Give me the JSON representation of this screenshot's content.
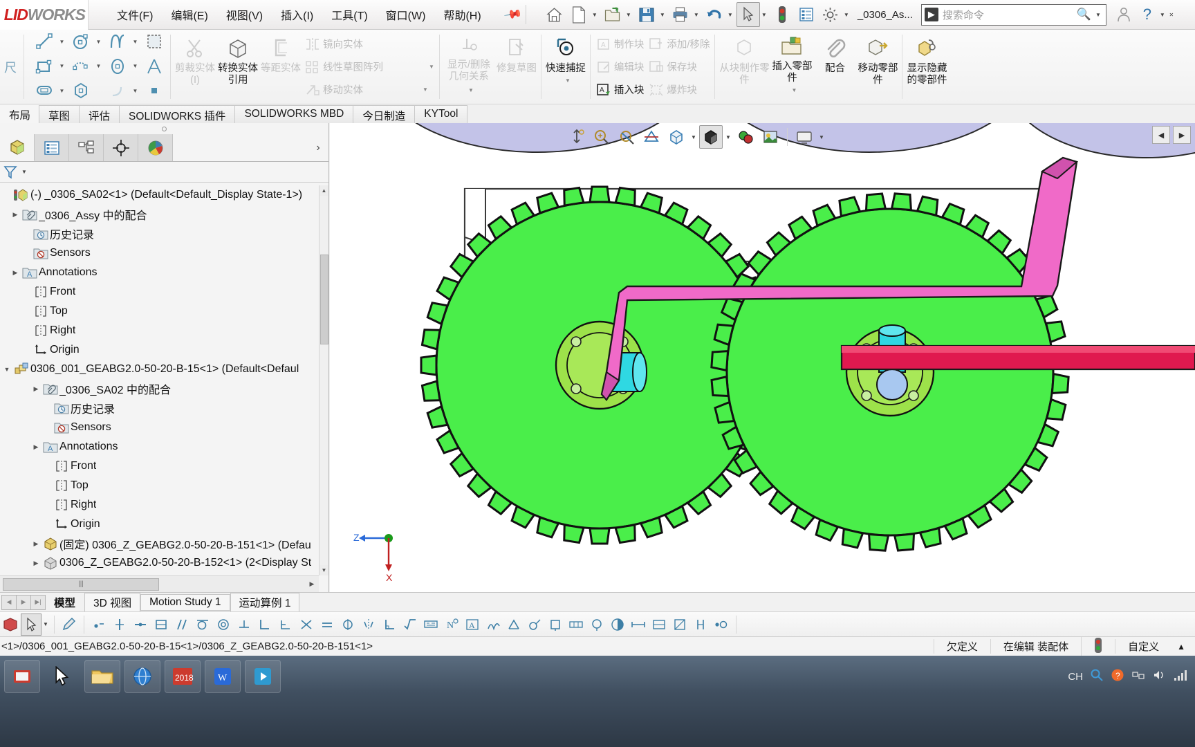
{
  "app": {
    "logo_part1": "LID",
    "logo_part2": "WORKS",
    "document_name": "_0306_As...",
    "search_placeholder": "搜索命令",
    "search_icon": "search-icon"
  },
  "menubar": {
    "items": [
      {
        "label": "文件(F)",
        "name": "menu-file"
      },
      {
        "label": "编辑(E)",
        "name": "menu-edit"
      },
      {
        "label": "视图(V)",
        "name": "menu-view"
      },
      {
        "label": "插入(I)",
        "name": "menu-insert"
      },
      {
        "label": "工具(T)",
        "name": "menu-tools"
      },
      {
        "label": "窗口(W)",
        "name": "menu-window"
      },
      {
        "label": "帮助(H)",
        "name": "menu-help"
      }
    ],
    "pin": "pin-icon"
  },
  "quick_access": [
    {
      "name": "home-icon",
      "caret": false
    },
    {
      "name": "new-document-icon",
      "caret": true
    },
    {
      "name": "open-folder-icon",
      "caret": true
    },
    {
      "name": "save-icon",
      "caret": true
    },
    {
      "name": "print-icon",
      "caret": true
    },
    {
      "name": "undo-icon",
      "caret": true
    },
    {
      "name": "select-cursor-icon",
      "caret": true
    },
    {
      "name": "rebuild-icon",
      "caret": false
    },
    {
      "name": "options-list-icon",
      "caret": false
    },
    {
      "name": "settings-gear-icon",
      "caret": true
    }
  ],
  "ribbon": {
    "sketch_entities": [
      {
        "name": "line-icon",
        "caret": true
      },
      {
        "name": "circle-icon",
        "caret": true
      },
      {
        "name": "spline-icon",
        "caret": true
      },
      {
        "name": "sketch-fillet-icon",
        "caret": false
      },
      {
        "name": "rectangle-icon",
        "caret": true
      },
      {
        "name": "slot-icon",
        "caret": true
      },
      {
        "name": "ellipse-icon",
        "caret": true
      },
      {
        "name": "text-icon",
        "caret": false
      },
      {
        "name": "straight-slot-icon",
        "caret": true
      },
      {
        "name": "polygon-icon",
        "caret": false
      },
      {
        "name": "arc-icon",
        "caret": true
      },
      {
        "name": "point-icon",
        "caret": false
      }
    ],
    "big_buttons": [
      {
        "label": "剪裁实体(I)",
        "name": "trim-entities-button",
        "dim": true,
        "icon": "trim-icon"
      },
      {
        "label": "转换实体引用",
        "name": "convert-entities-button",
        "dim": false,
        "icon": "convert-entities-icon"
      },
      {
        "label": "等距实体",
        "name": "offset-entities-button",
        "dim": true,
        "icon": "offset-entities-icon"
      }
    ],
    "mid_small": [
      {
        "label": "镜向实体",
        "name": "mirror-entities-button",
        "icon": "mirror-icon",
        "caret": false
      },
      {
        "label": "线性草图阵列",
        "name": "linear-pattern-button",
        "icon": "linear-pattern-icon",
        "caret": true
      },
      {
        "label": "移动实体",
        "name": "move-entities-button",
        "icon": "move-entities-icon",
        "caret": true
      }
    ],
    "relations": [
      {
        "label": "显示/删除几何关系",
        "name": "display-delete-relations-button",
        "dim": true,
        "icon": "relations-icon",
        "caret": true
      },
      {
        "label": "修复草图",
        "name": "repair-sketch-button",
        "dim": true,
        "icon": "repair-sketch-icon",
        "caret": false
      },
      {
        "label": "快速捕捉",
        "name": "quick-snaps-button",
        "dim": false,
        "icon": "quick-snap-icon",
        "caret": true
      }
    ],
    "blocks": [
      {
        "label": "制作块",
        "name": "make-block-button",
        "icon": "make-block-icon",
        "dim": true
      },
      {
        "label": "编辑块",
        "name": "edit-block-button",
        "icon": "edit-block-icon",
        "dim": true
      },
      {
        "label": "插入块",
        "name": "insert-block-button",
        "icon": "insert-block-icon",
        "dim": false
      },
      {
        "label": "添加/移除",
        "name": "add-remove-button",
        "icon": "add-remove-icon",
        "dim": true
      },
      {
        "label": "保存块",
        "name": "save-block-button",
        "icon": "save-block-icon",
        "dim": true
      },
      {
        "label": "爆炸块",
        "name": "explode-block-button",
        "icon": "explode-block-icon",
        "dim": true
      }
    ],
    "assembly": [
      {
        "label": "从块制作零件",
        "name": "make-part-from-block-button",
        "dim": true,
        "icon": "make-part-icon",
        "caret": false
      },
      {
        "label": "插入零部件",
        "name": "insert-components-button",
        "dim": false,
        "icon": "insert-component-icon",
        "caret": true
      },
      {
        "label": "配合",
        "name": "mate-button",
        "dim": false,
        "icon": "mate-paperclip-icon",
        "caret": false
      },
      {
        "label": "移动零部件",
        "name": "move-component-button",
        "dim": false,
        "icon": "move-component-icon",
        "caret": false
      },
      {
        "label": "显示隐藏的零部件",
        "name": "show-hidden-components-button",
        "dim": false,
        "icon": "show-hidden-icon",
        "caret": false
      }
    ]
  },
  "command_tabs": [
    {
      "label": "布局",
      "name": "tab-layout",
      "selected": true
    },
    {
      "label": "草图",
      "name": "tab-sketch",
      "selected": false
    },
    {
      "label": "评估",
      "name": "tab-evaluate",
      "selected": false
    },
    {
      "label": "SOLIDWORKS 插件",
      "name": "tab-solidworks-addins",
      "selected": false
    },
    {
      "label": "SOLIDWORKS MBD",
      "name": "tab-solidworks-mbd",
      "selected": false
    },
    {
      "label": "今日制造",
      "name": "tab-manufacturing-today",
      "selected": false
    },
    {
      "label": "KYTool",
      "name": "tab-kytool",
      "selected": false
    }
  ],
  "left_panel": {
    "tabs": [
      {
        "name": "feature-manager-tab",
        "icon": "feature-tree-icon",
        "selected": true
      },
      {
        "name": "property-manager-tab",
        "icon": "property-list-icon",
        "selected": false
      },
      {
        "name": "configuration-manager-tab",
        "icon": "configuration-icon",
        "selected": false
      },
      {
        "name": "dimxpert-manager-tab",
        "icon": "dimxpert-icon",
        "selected": false
      },
      {
        "name": "display-manager-tab",
        "icon": "appearance-sphere-icon",
        "selected": false
      }
    ],
    "filter_icon": "filter-icon",
    "tree": [
      {
        "label": "(-) _0306_SA02<1>  (Default<Default_Display State-1>)",
        "indent": 0,
        "expander": "",
        "icon": "assembly-icon",
        "name": "tree-root-assembly"
      },
      {
        "label": "_0306_Assy 中的配合",
        "indent": 1,
        "expander": "collapsed",
        "icon": "mates-folder-icon",
        "name": "tree-mates-folder"
      },
      {
        "label": "历史记录",
        "indent": 1,
        "expander": "",
        "icon": "history-folder-icon",
        "name": "tree-history"
      },
      {
        "label": "Sensors",
        "indent": 1,
        "expander": "",
        "icon": "sensors-folder-icon",
        "name": "tree-sensors"
      },
      {
        "label": "Annotations",
        "indent": 1,
        "expander": "collapsed",
        "icon": "annotations-folder-icon",
        "name": "tree-annotations"
      },
      {
        "label": "Front",
        "indent": 1,
        "expander": "",
        "icon": "plane-icon",
        "name": "tree-plane-front"
      },
      {
        "label": "Top",
        "indent": 1,
        "expander": "",
        "icon": "plane-icon",
        "name": "tree-plane-top"
      },
      {
        "label": "Right",
        "indent": 1,
        "expander": "",
        "icon": "plane-icon",
        "name": "tree-plane-right"
      },
      {
        "label": "Origin",
        "indent": 1,
        "expander": "",
        "icon": "origin-icon",
        "name": "tree-origin"
      },
      {
        "label": "0306_001_GEABG2.0-50-20-B-15<1>  (Default<Defaul",
        "indent": 0,
        "expander": "expanded",
        "icon": "subassembly-icon",
        "name": "tree-subassembly"
      },
      {
        "label": "_0306_SA02 中的配合",
        "indent": 2,
        "expander": "collapsed",
        "icon": "mates-folder-icon",
        "name": "tree-sub-mates-folder"
      },
      {
        "label": "历史记录",
        "indent": 2,
        "expander": "",
        "icon": "history-folder-icon",
        "name": "tree-sub-history"
      },
      {
        "label": "Sensors",
        "indent": 2,
        "expander": "",
        "icon": "sensors-folder-icon",
        "name": "tree-sub-sensors"
      },
      {
        "label": "Annotations",
        "indent": 2,
        "expander": "collapsed",
        "icon": "annotations-folder-icon",
        "name": "tree-sub-annotations"
      },
      {
        "label": "Front",
        "indent": 2,
        "expander": "",
        "icon": "plane-icon",
        "name": "tree-sub-plane-front"
      },
      {
        "label": "Top",
        "indent": 2,
        "expander": "",
        "icon": "plane-icon",
        "name": "tree-sub-plane-top"
      },
      {
        "label": "Right",
        "indent": 2,
        "expander": "",
        "icon": "plane-icon",
        "name": "tree-sub-plane-right"
      },
      {
        "label": "Origin",
        "indent": 2,
        "expander": "",
        "icon": "origin-icon",
        "name": "tree-sub-origin"
      },
      {
        "label": "(固定) 0306_Z_GEABG2.0-50-20-B-151<1>  (Defau",
        "indent": 1,
        "expander": "collapsed",
        "icon": "part-icon",
        "name": "tree-part-151"
      },
      {
        "label": "0306_Z_GEABG2.0-50-20-B-152<1>  (2<Display St",
        "indent": 1,
        "expander": "collapsed",
        "icon": "part-icon",
        "name": "tree-part-152"
      }
    ],
    "hscroll_grip": "|||"
  },
  "view_toolbar": [
    {
      "name": "zoom-to-fit-icon",
      "caret": false,
      "active": false
    },
    {
      "name": "zoom-to-area-icon",
      "caret": false,
      "active": false
    },
    {
      "name": "previous-view-icon",
      "caret": false,
      "active": false
    },
    {
      "name": "section-view-icon",
      "caret": false,
      "active": false
    },
    {
      "name": "view-orientation-icon",
      "caret": true,
      "active": false
    },
    {
      "name": "display-style-icon",
      "caret": true,
      "active": true
    },
    {
      "name": "hide-show-items-icon",
      "caret": false,
      "active": false
    },
    {
      "name": "apply-scene-icon",
      "caret": false,
      "active": false
    },
    {
      "name": "view-settings-icon",
      "caret": true,
      "active": false
    }
  ],
  "graphics": {
    "triad": {
      "z_label": "Z",
      "x_label": "X"
    }
  },
  "bottom_tabs": [
    {
      "label": "模型",
      "name": "bottom-tab-model",
      "selected": true,
      "boxed": false
    },
    {
      "label": "3D 视图",
      "name": "bottom-tab-3d-views",
      "selected": false,
      "boxed": true
    },
    {
      "label": "Motion Study 1",
      "name": "bottom-tab-motion-study-1",
      "selected": false,
      "boxed": true
    },
    {
      "label": "运动算例 1",
      "name": "bottom-tab-motion-analysis-1",
      "selected": false,
      "boxed": true
    }
  ],
  "status_bar": {
    "path": "<1>/0306_001_GEABG2.0-50-20-B-15<1>/0306_Z_GEABG2.0-50-20-B-151<1>",
    "under_defined": "欠定义",
    "editing": "在编辑 装配体",
    "rebuild_indicator": "rebuild-status-icon",
    "customize": "自定义",
    "expand_caret": "▲"
  },
  "taskbar": {
    "apps": [
      {
        "name": "taskbar-start-icon"
      },
      {
        "name": "taskbar-cursor-icon"
      },
      {
        "name": "taskbar-explorer-icon"
      },
      {
        "name": "taskbar-browser-icon"
      },
      {
        "name": "taskbar-solidworks-2018-icon"
      },
      {
        "name": "taskbar-wps-icon"
      },
      {
        "name": "taskbar-media-icon"
      }
    ],
    "tray": {
      "ime": "CH",
      "icons": [
        "tray-search-icon",
        "tray-help-icon",
        "tray-network-icon",
        "tray-volume-icon",
        "tray-signal-icon"
      ]
    }
  }
}
